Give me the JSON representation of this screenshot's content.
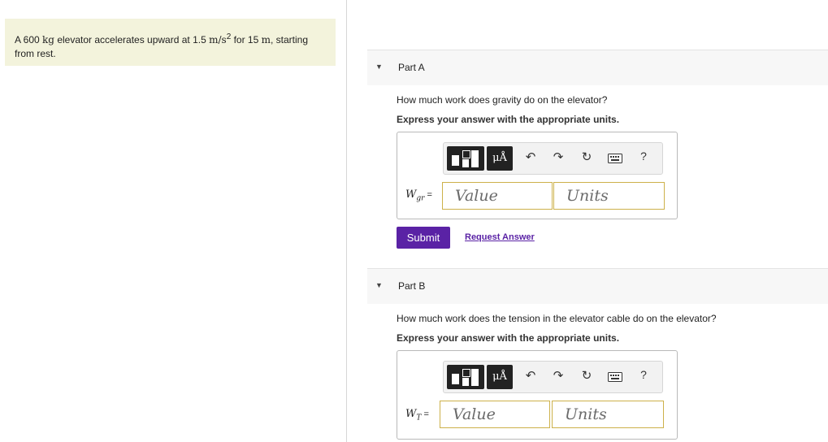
{
  "problem": {
    "pre1": "A 600 ",
    "unit_kg": "kg",
    "pre2": " elevator accelerates upward at 1.5 ",
    "unit_accel": "m/s",
    "accel_exp": "2",
    "pre3": " for 15 ",
    "unit_m": "m",
    "pre4": ", starting",
    "line2": "from rest."
  },
  "toolbar": {
    "units_label": "μÅ",
    "undo_icon": "↶",
    "redo_icon": "↷",
    "reset_icon": "↻",
    "help": "?"
  },
  "partA": {
    "title": "Part A",
    "question": "How much work does gravity do on the elevator?",
    "instruction": "Express your answer with the appropriate units.",
    "var_main": "W",
    "var_sub": "gr",
    "equals": " =",
    "value_placeholder": "Value",
    "units_placeholder": "Units",
    "submit": "Submit",
    "request": "Request Answer"
  },
  "partB": {
    "title": "Part B",
    "question": "How much work does the tension in the elevator cable do on the elevator?",
    "instruction": "Express your answer with the appropriate units.",
    "var_main": "W",
    "var_sub": "T",
    "equals": " =",
    "value_placeholder": "Value",
    "units_placeholder": "Units"
  }
}
